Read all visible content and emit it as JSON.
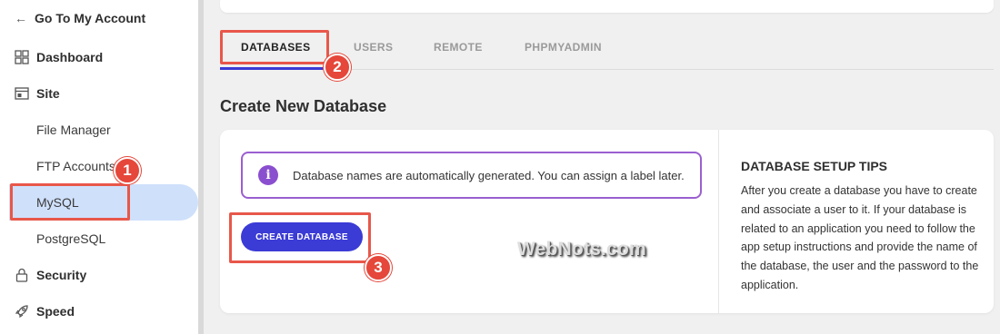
{
  "sidebar": {
    "back_label": "Go To My Account",
    "items": [
      {
        "label": "Dashboard",
        "icon": "grid-icon"
      },
      {
        "label": "Site",
        "icon": "site-icon"
      },
      {
        "label": "File Manager"
      },
      {
        "label": "FTP Accounts"
      },
      {
        "label": "MySQL",
        "active": true
      },
      {
        "label": "PostgreSQL"
      },
      {
        "label": "Security",
        "icon": "lock-icon"
      },
      {
        "label": "Speed",
        "icon": "rocket-icon"
      }
    ]
  },
  "tabs": [
    "DATABASES",
    "USERS",
    "REMOTE",
    "PHPMYADMIN"
  ],
  "section_title": "Create New Database",
  "notice": {
    "icon": "info-icon",
    "text": "Database names are automatically generated. You can assign a label later."
  },
  "create_button": "CREATE DATABASE",
  "watermark": "WebNots.com",
  "tips": {
    "title": "DATABASE SETUP TIPS",
    "text": "After you create a database you have to create and associate a user to it. If your database is related to an application you need to follow the app setup instructions and provide the name of the database, the user and the password to the application."
  },
  "annotations": {
    "badge_1": "1",
    "badge_2": "2",
    "badge_3": "3"
  },
  "colors": {
    "accent": "#3b3bd6",
    "highlight": "#e8574a",
    "notice_border": "#9a5fd0",
    "active_bg": "#cfe0fb"
  }
}
